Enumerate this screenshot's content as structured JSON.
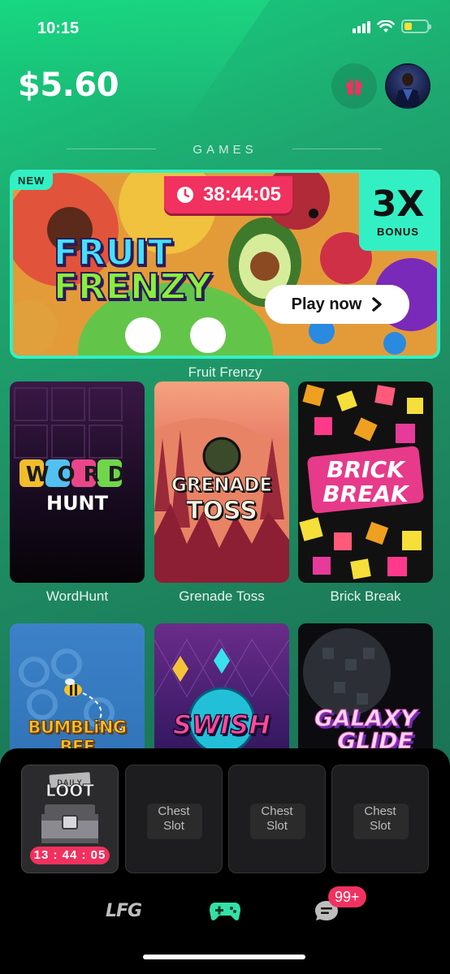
{
  "status": {
    "time": "10:15",
    "battery_level": 0.35,
    "battery_color": "#f8e03a"
  },
  "header": {
    "balance": "$5.60",
    "gift_icon": "gift-icon",
    "avatar_icon": "avatar"
  },
  "games_section": {
    "title": "GAMES"
  },
  "featured": {
    "badge": "NEW",
    "timer": "38:44:05",
    "bonus_multiplier": "3X",
    "bonus_label": "BONUS",
    "logo_line1": "FRUIT",
    "logo_line2": "FRENZY",
    "play_label": "Play now",
    "caption": "Fruit Frenzy",
    "accent": "#33f0c4",
    "timer_color": "#f1315f"
  },
  "games": [
    {
      "name": "WordHunt",
      "art_line1": "WORD",
      "art_line2": "HUNT"
    },
    {
      "name": "Grenade Toss",
      "art_line1": "GRENADE",
      "art_line2": "TOSS"
    },
    {
      "name": "Brick Break",
      "art_line1": "BRICK",
      "art_line2": "BREAK"
    },
    {
      "name": "Bumbling Bee",
      "art_line1": "BUMBLiNG BEE"
    },
    {
      "name": "Swish",
      "art_line1": "SWISH"
    },
    {
      "name": "Galaxy Glide",
      "art_line1": "GALAXY",
      "art_line2": "GLIDE"
    }
  ],
  "loot": {
    "daily_label_top": "DAILY",
    "daily_label_bottom": "LOOT",
    "daily_timer": "13 : 44 : 05",
    "slots": [
      {
        "label": "Chest\nSlot"
      },
      {
        "label": "Chest\nSlot"
      },
      {
        "label": "Chest\nSlot"
      }
    ]
  },
  "nav": {
    "lfg_label": "LFG",
    "games_icon": "gamepad-icon",
    "chat_icon": "chat-icon",
    "chat_badge": "99+"
  }
}
